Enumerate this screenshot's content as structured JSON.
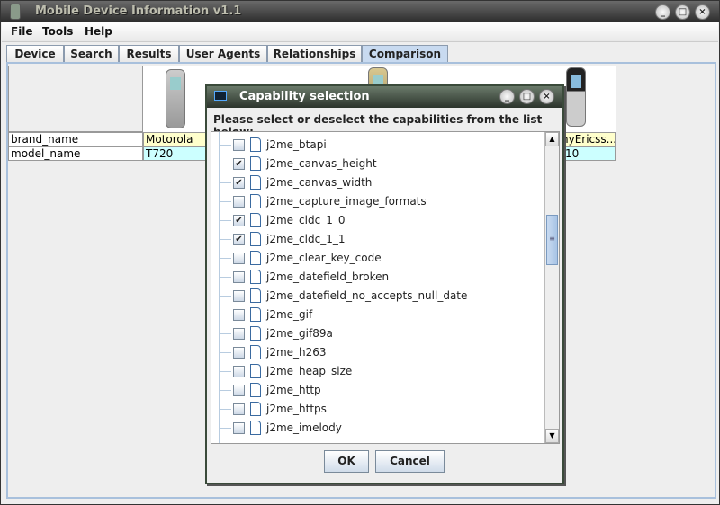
{
  "window": {
    "title": "Mobile Device Information v1.1",
    "controls": [
      "minimize",
      "maximize",
      "close"
    ]
  },
  "menu": [
    "File",
    "Tools",
    "Help"
  ],
  "tabs": [
    {
      "label": "Device"
    },
    {
      "label": "Search"
    },
    {
      "label": "Results"
    },
    {
      "label": "User Agents"
    },
    {
      "label": "Relationships"
    },
    {
      "label": "Comparison",
      "active": true
    }
  ],
  "table": {
    "rows": [
      {
        "header": "brand_name",
        "first": "Motorola",
        "last": "nyEricss..."
      },
      {
        "header": "model_name",
        "first": "T720",
        "last": "10"
      }
    ],
    "colors": {
      "brand": "#ffffcc",
      "model": "#ccffff"
    }
  },
  "dialog": {
    "title": "Capability selection",
    "instruction": "Please select or deselect the capabilities from the list below:",
    "items": [
      {
        "label": "j2me_btapi",
        "checked": false
      },
      {
        "label": "j2me_canvas_height",
        "checked": true
      },
      {
        "label": "j2me_canvas_width",
        "checked": true
      },
      {
        "label": "j2me_capture_image_formats",
        "checked": false
      },
      {
        "label": "j2me_cldc_1_0",
        "checked": true
      },
      {
        "label": "j2me_cldc_1_1",
        "checked": true
      },
      {
        "label": "j2me_clear_key_code",
        "checked": false
      },
      {
        "label": "j2me_datefield_broken",
        "checked": false
      },
      {
        "label": "j2me_datefield_no_accepts_null_date",
        "checked": false
      },
      {
        "label": "j2me_gif",
        "checked": false
      },
      {
        "label": "j2me_gif89a",
        "checked": false
      },
      {
        "label": "j2me_h263",
        "checked": false
      },
      {
        "label": "j2me_heap_size",
        "checked": false
      },
      {
        "label": "j2me_http",
        "checked": false
      },
      {
        "label": "j2me_https",
        "checked": false
      },
      {
        "label": "j2me_imelody",
        "checked": false
      }
    ],
    "ok_label": "OK",
    "cancel_label": "Cancel"
  }
}
